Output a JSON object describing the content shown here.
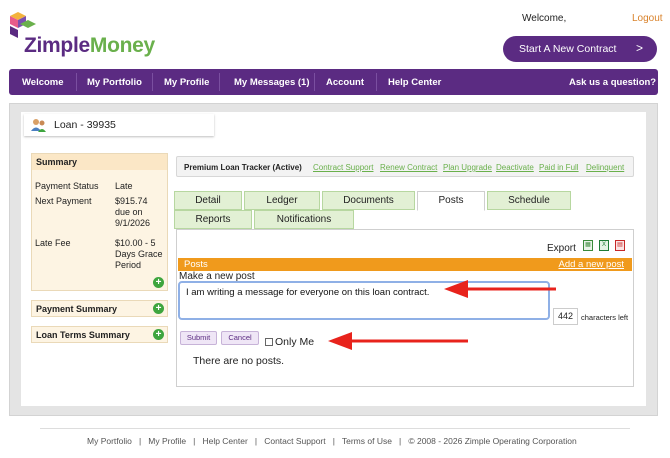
{
  "header": {
    "brand_first": "Zimple",
    "brand_second": "Money",
    "welcome": "Welcome,",
    "logout": "Logout",
    "start_button": "Start A New Contract",
    "start_chevron": ">"
  },
  "nav": [
    "Welcome",
    "My Portfolio",
    "My Profile",
    "My Messages (1)",
    "Account",
    "Help Center",
    "Ask us a question?"
  ],
  "loan": {
    "title": "Loan - 39935"
  },
  "summary": {
    "title": "Summary",
    "payment_status_label": "Payment Status",
    "payment_status_value": "Late",
    "next_payment_label": "Next Payment",
    "next_payment_value": "$915.74 due on 9/1/2026",
    "late_fee_label": "Late Fee",
    "late_fee_value": "$10.00 - 5 Days Grace Period"
  },
  "panels": {
    "payment_summary": "Payment Summary",
    "loan_terms_summary": "Loan Terms Summary"
  },
  "tracker": {
    "title": "Premium Loan Tracker (Active)",
    "links": [
      "Contract Support",
      "Renew Contract",
      "Plan Upgrade",
      "Deactivate",
      "Paid in Full",
      "Delinquent"
    ]
  },
  "tabs": [
    "Detail",
    "Ledger",
    "Documents",
    "Posts",
    "Schedule",
    "Reports",
    "Notifications"
  ],
  "active_tab": "Posts",
  "posts": {
    "export_label": "Export",
    "bar_title": "Posts",
    "add_link": "Add a new post",
    "make_post_label": "Make a new post",
    "message": "I am writing a message for everyone on this loan contract.",
    "chars_left": "442",
    "chars_left_label": "characters left",
    "submit": "Submit",
    "cancel": "Cancel",
    "only_me": "Only Me",
    "no_posts": "There are no posts."
  },
  "footer": {
    "links": [
      "My Portfolio",
      "My Profile",
      "Help Center",
      "Contact Support",
      "Terms of Use"
    ],
    "copyright": "© 2008 - 2026 Zimple Operating Corporation"
  },
  "colors": {
    "brand_purple": "#5b2b82",
    "brand_green": "#6ab04c",
    "accent_orange": "#f09a1c",
    "arrow_red": "#e8231c"
  }
}
